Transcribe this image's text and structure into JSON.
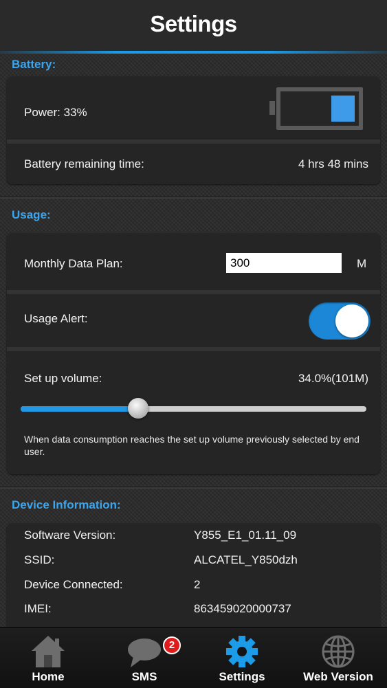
{
  "header": {
    "title": "Settings"
  },
  "battery": {
    "section_title": "Battery:",
    "power_label": "Power: 33%",
    "power_level": 0.33,
    "remaining_label": "Battery remaining time:",
    "remaining_value": "4 hrs 48 mins"
  },
  "usage": {
    "section_title": "Usage:",
    "plan_label": "Monthly Data Plan:",
    "plan_value": "300",
    "plan_unit": "M",
    "alert_label": "Usage Alert:",
    "alert_on": true,
    "volume_label": "Set up volume:",
    "volume_value": "34.0%(101M)",
    "volume_fraction": 0.34,
    "volume_note": "When data consumption reaches the set up volume previously selected by end user."
  },
  "device": {
    "section_title": "Device Information:",
    "rows": [
      {
        "label": "Software Version:",
        "value": "Y855_E1_01.11_09"
      },
      {
        "label": "SSID:",
        "value": "ALCATEL_Y850dzh"
      },
      {
        "label": "Device Connected:",
        "value": "2"
      },
      {
        "label": "IMEI:",
        "value": "863459020000737"
      }
    ]
  },
  "tabbar": {
    "tabs": [
      {
        "label": "Home",
        "icon": "home-icon"
      },
      {
        "label": "SMS",
        "icon": "chat-bubble-icon",
        "badge": "2"
      },
      {
        "label": "Settings",
        "icon": "gear-icon",
        "active": true
      },
      {
        "label": "Web Version",
        "icon": "globe-icon"
      }
    ]
  },
  "colors": {
    "accent": "#1c9be8",
    "section_title": "#3aa6f0",
    "badge": "#e01b1b"
  }
}
